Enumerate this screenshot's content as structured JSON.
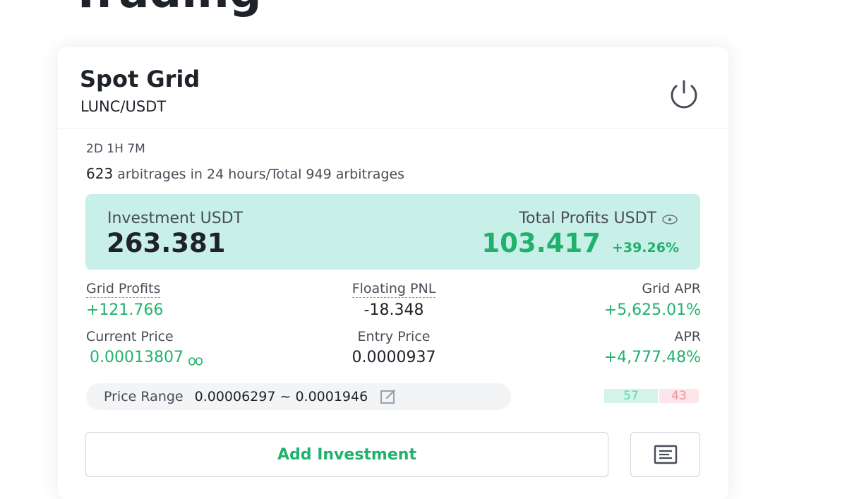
{
  "page": {
    "heading_fragment": "Trading"
  },
  "card": {
    "title": "Spot Grid",
    "pair": "LUNC/USDT",
    "power_icon": "power-icon",
    "runtime": "2D 1H 7M",
    "arbitrage": {
      "count_24h": "623",
      "text": " arbitrages in 24 hours/Total 949 arbitrages"
    },
    "summary": {
      "investment_label": "Investment USDT",
      "investment_value": "263.381",
      "profits_label": "Total Profits USDT",
      "profits_icon": "eye-icon",
      "profits_value": "103.417",
      "profits_pct": "+39.26%"
    },
    "stats": {
      "grid_profits_label": "Grid Profits",
      "grid_profits_value": "+121.766",
      "floating_pnl_label": "Floating PNL",
      "floating_pnl_value": "-18.348",
      "grid_apr_label": "Grid APR",
      "grid_apr_value": "+5,625.01%",
      "current_price_label": "Current Price",
      "current_price_value": "0.00013807",
      "current_price_icon": "infinity-icon",
      "entry_price_label": "Entry Price",
      "entry_price_value": "0.0000937",
      "apr_label": "APR",
      "apr_value": "+4,777.48%"
    },
    "price_range": {
      "label": "Price Range",
      "value": "0.00006297 ~ 0.0001946",
      "edit_icon": "edit-icon"
    },
    "order_ratio": {
      "buy": "57",
      "sell": "43"
    },
    "actions": {
      "add_investment": "Add Investment",
      "details_icon": "list-icon"
    }
  },
  "colors": {
    "accent_green": "#20b26c",
    "summary_bg": "#c9f0e8",
    "buy_bg": "#d4f3ea",
    "sell_bg": "#fde6e9"
  }
}
